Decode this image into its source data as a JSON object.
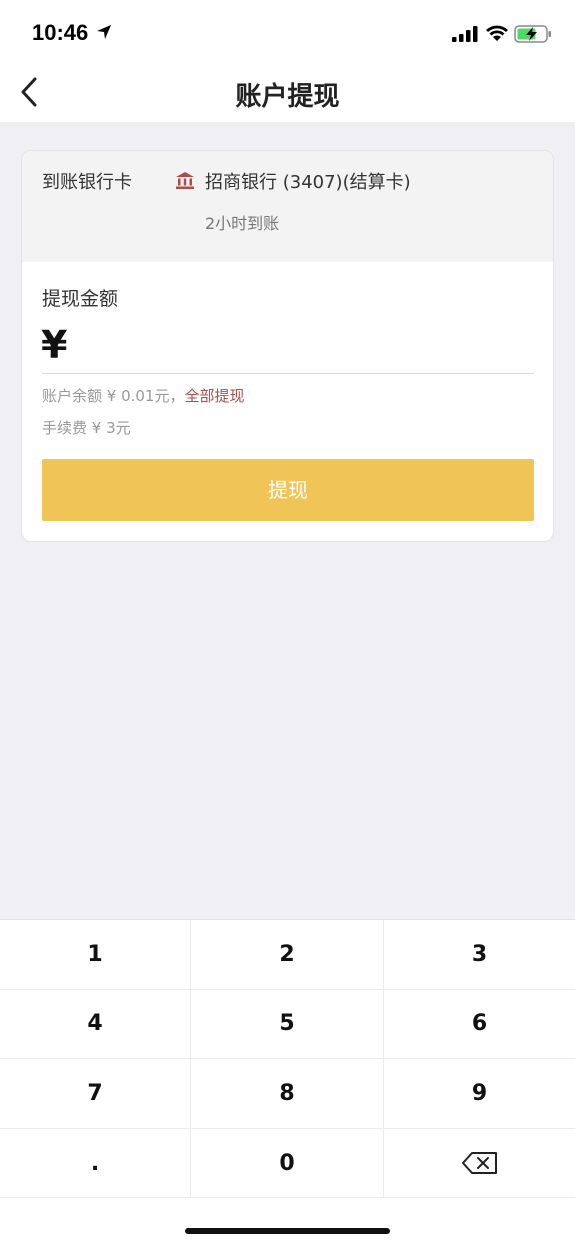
{
  "status": {
    "time": "10:46"
  },
  "nav": {
    "title": "账户提现"
  },
  "bank": {
    "label": "到账银行卡",
    "name": "招商银行 (3407)(结算卡)",
    "arrival": "2小时到账"
  },
  "amount": {
    "label": "提现金额",
    "currency": "¥",
    "value": "",
    "balance_text": "账户余额 ¥ 0.01元，",
    "withdraw_all": "全部提现",
    "fee_text": "手续费 ¥ 3元"
  },
  "button": {
    "withdraw_label": "提现"
  },
  "keypad": {
    "keys": [
      "1",
      "2",
      "3",
      "4",
      "5",
      "6",
      "7",
      "8",
      "9",
      ".",
      "0"
    ]
  },
  "colors": {
    "accent": "#f1c458",
    "link": "#b24a4a",
    "bank_icon": "#b24a4a"
  }
}
